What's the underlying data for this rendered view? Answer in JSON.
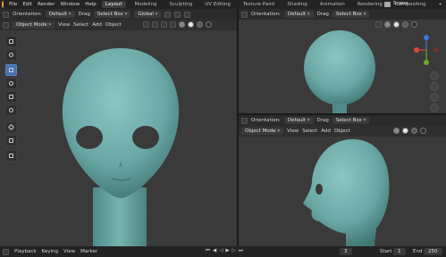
{
  "topbar": {
    "menus": [
      "File",
      "Edit",
      "Render",
      "Window",
      "Help"
    ],
    "workspaces": [
      "Layout",
      "Modeling",
      "Sculpting",
      "UV Editing",
      "Texture Paint",
      "Shading",
      "Animation",
      "Rendering",
      "Compositing"
    ],
    "active_workspace": "Layout",
    "add_tab": "+",
    "scene": "Scene"
  },
  "left_header": {
    "orientation_label": "Orientation:",
    "orientation_value": "Default",
    "drag_label": "Drag",
    "drag_value": "Select Box",
    "transform_value": "Global",
    "mode": "Object Mode",
    "menus": [
      "View",
      "Select",
      "Add",
      "Object"
    ]
  },
  "right_top_header": {
    "orientation_label": "Orientation:",
    "orientation_value": "Default",
    "drag_label": "Drag",
    "drag_value": "Select Box"
  },
  "right_bottom_header": {
    "orientation_label": "Orientation:",
    "orientation_value": "Default",
    "drag_label": "Drag",
    "drag_value": "Select Box",
    "mode": "Object Mode",
    "menus": [
      "View",
      "Select",
      "Add",
      "Object"
    ]
  },
  "timeline": {
    "menus": [
      "Playback",
      "Keying",
      "View",
      "Marker"
    ],
    "current_frame": "3",
    "start_label": "Start",
    "start_value": "1",
    "end_label": "End",
    "end_value": "250"
  },
  "colors": {
    "model": "#6aa8a6",
    "accent": "#4772b3",
    "viewport": "#3a3a3a",
    "axis_x": "#d9453b",
    "axis_y": "#6ea82e",
    "axis_z": "#3a78d8"
  },
  "icons": {
    "toolbar": [
      "select-box-icon",
      "cursor-icon",
      "move-icon",
      "rotate-icon",
      "scale-icon",
      "transform-icon",
      "annotate-icon",
      "measure-icon",
      "add-cube-icon"
    ],
    "nav": [
      "zoom-icon",
      "hand-pan-icon",
      "camera-icon",
      "grid-icon"
    ]
  }
}
